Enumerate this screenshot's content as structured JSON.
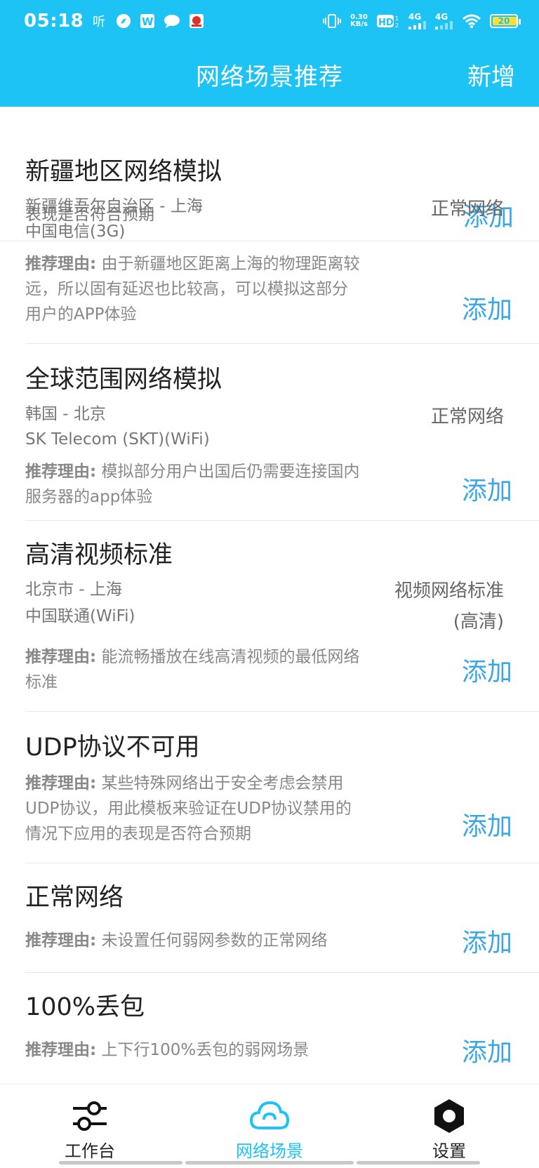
{
  "status_bar": {
    "time": "05:18",
    "netspeed_value": "0.30",
    "netspeed_unit": "KB/s",
    "hd_label": "HD",
    "sig1": "4G",
    "sig2": "4G",
    "battery": "20"
  },
  "header": {
    "title": "网络场景推荐",
    "add_label": "新增"
  },
  "partial": {
    "text": "表现是否符合预期",
    "add": "添加"
  },
  "reason_label": "推荐理由:",
  "add_label": "添加",
  "cards": [
    {
      "title": "新疆地区网络模拟",
      "route": "新疆维吾尔自治区 - 上海",
      "carrier": "中国电信(3G)",
      "network": "正常网络",
      "reason_l1": "由于新疆地区距离上海的物理距离较",
      "reason_l2": "远，所以固有延迟也比较高，可以模拟这部分",
      "reason_l3": "用户的APP体验"
    },
    {
      "title": "全球范围网络模拟",
      "route": "韩国 - 北京",
      "carrier": "SK Telecom (SKT)(WiFi)",
      "network": "正常网络",
      "reason_l1": "模拟部分用户出国后仍需要连接国内",
      "reason_l2": "服务器的app体验"
    },
    {
      "title": "高清视频标准",
      "route": "北京市 - 上海",
      "carrier": "中国联通(WiFi)",
      "network_l1": "视频网络标准",
      "network_l2": "(高清)",
      "reason_l1": "能流畅播放在线高清视频的最低网络",
      "reason_l2": "标准"
    },
    {
      "title": "UDP协议不可用",
      "reason_l1": "某些特殊网络出于安全考虑会禁用",
      "reason_l2": "UDP协议，用此模板来验证在UDP协议禁用的",
      "reason_l3": "情况下应用的表现是否符合预期"
    },
    {
      "title": "正常网络",
      "reason_l1": "未设置任何弱网参数的正常网络"
    },
    {
      "title": "100%丢包",
      "reason_l1": "上下行100%丢包的弱网场景"
    }
  ],
  "bottom_nav": {
    "items": [
      {
        "label": "工作台",
        "icon": "sliders-icon"
      },
      {
        "label": "网络场景",
        "icon": "cloud-icon",
        "active": true
      },
      {
        "label": "设置",
        "icon": "gear-icon"
      }
    ]
  },
  "colors": {
    "header": "#1ec3f5",
    "link": "#3aa7e8"
  }
}
